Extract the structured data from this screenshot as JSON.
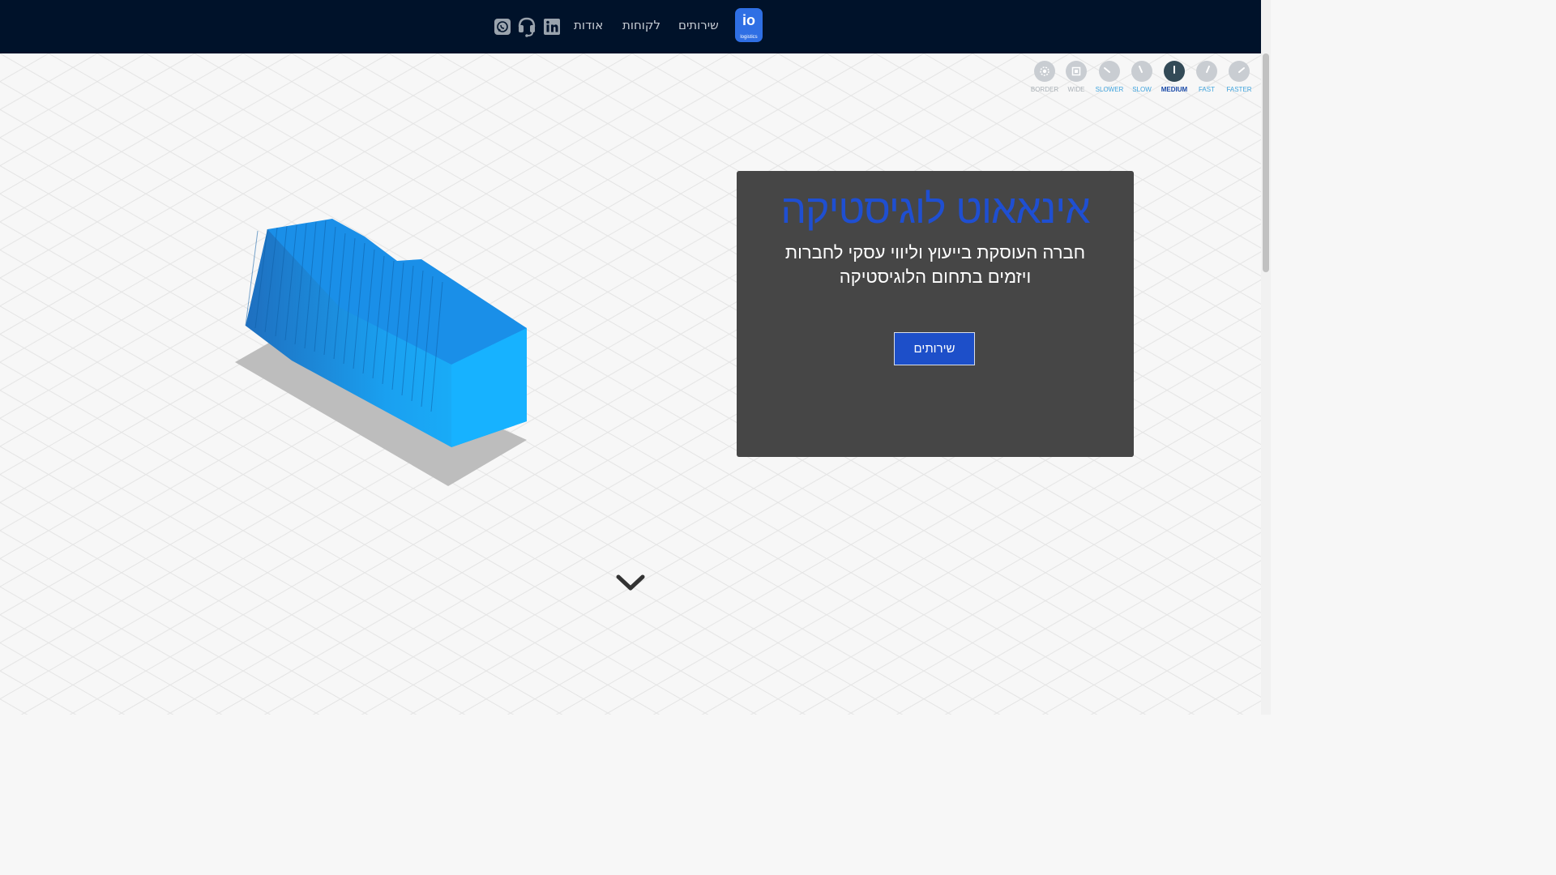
{
  "header": {
    "logo_text": "io",
    "logo_subtext": "logistics",
    "nav": {
      "services": "שירותים",
      "clients": "לקוחות",
      "about": "אודות"
    },
    "icons": [
      "linkedin-icon",
      "headset-support-icon",
      "whatsapp-icon"
    ],
    "background_color": "#00122a",
    "logo_color": "#2f6fe4"
  },
  "speed_controls": [
    {
      "label": "BORDER",
      "icon": "border-icon"
    },
    {
      "label": "WIDE",
      "icon": "wide-icon"
    },
    {
      "label": "SLOWER",
      "icon": "slower-gauge-icon"
    },
    {
      "label": "SLOW",
      "icon": "slow-gauge-icon"
    },
    {
      "label": "MEDIUM",
      "icon": "medium-gauge-icon",
      "active": true
    },
    {
      "label": "FAST",
      "icon": "fast-gauge-icon"
    },
    {
      "label": "FASTER",
      "icon": "faster-gauge-icon"
    }
  ],
  "hero": {
    "title": "אינאאוט לוגיסטיקה",
    "subtitle_line1": "חברה העוסקת בייעוץ וליווי עסקי לחברות",
    "subtitle_line2": "ויזמים בתחום הלוגיסטיקה",
    "button_label": "שירותים",
    "title_color": "#1f4fd1",
    "card_color": "#464646"
  },
  "scroll_icon": "chevron-down-icon"
}
